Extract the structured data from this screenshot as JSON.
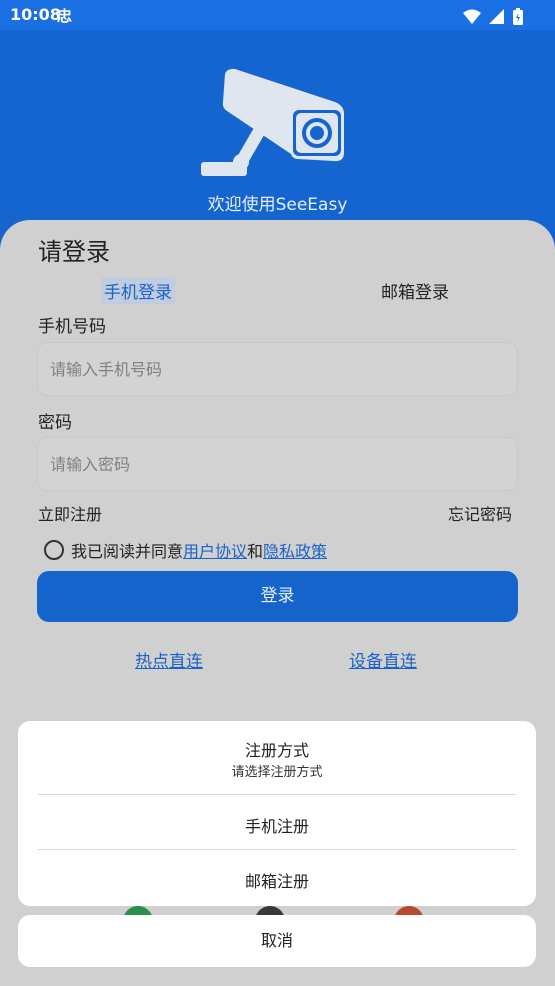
{
  "status_bar": {
    "time": "10:08",
    "app_icon": "忠",
    "icons": [
      "wifi-icon",
      "signal-icon",
      "battery-icon"
    ]
  },
  "hero": {
    "logo": "security-camera-icon",
    "welcome": "欢迎使用SeeEasy"
  },
  "login": {
    "title": "请登录",
    "tabs": [
      {
        "label": "手机登录",
        "selected": true
      },
      {
        "label": "邮箱登录",
        "selected": false
      }
    ],
    "phone_label": "手机号码",
    "phone_placeholder": "请输入手机号码",
    "password_label": "密码",
    "password_placeholder": "请输入密码",
    "register_link": "立即注册",
    "forgot_link": "忘记密码",
    "agree": {
      "prefix": "我已阅读并同意",
      "user_agreement": "用户协议",
      "and": "和",
      "privacy_policy": "隐私政策",
      "checked": false
    },
    "login_button": "登录",
    "hotspot_link": "热点直连",
    "device_link": "设备直连"
  },
  "action_sheet": {
    "title": "注册方式",
    "subtitle": "请选择注册方式",
    "options": [
      "手机注册",
      "邮箱注册"
    ],
    "cancel": "取消"
  },
  "colors": {
    "primary": "#1565d0",
    "link": "#1b62c6",
    "overlay_bg": "#d0d0d0",
    "sheet_bg": "#ffffff"
  }
}
